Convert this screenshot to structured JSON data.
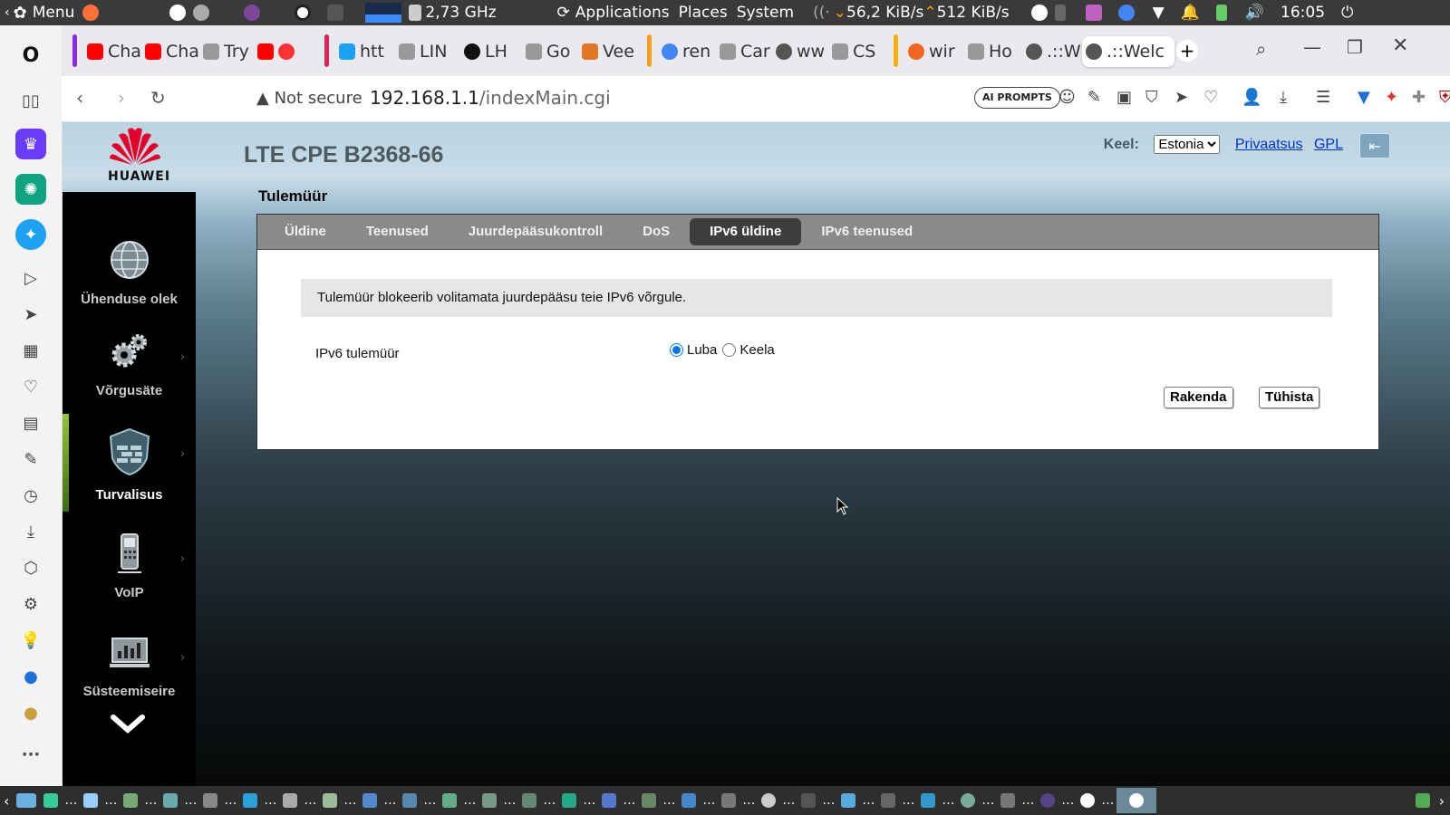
{
  "os_panel": {
    "menu_label": "Menu",
    "cpu_freq": "2,73 GHz",
    "applications": "Applications",
    "places": "Places",
    "system": "System",
    "net_down": "56,2 KiB/s",
    "net_up": "512 KiB/s",
    "clock": "16:05"
  },
  "browser": {
    "tabs": [
      {
        "label": "Cha",
        "color": "#ff0000"
      },
      {
        "label": "Cha",
        "color": "#ff0000"
      },
      {
        "label": "Try",
        "color": "#888888"
      },
      {
        "label": "",
        "color": "#ff0000"
      },
      {
        "label": "htt",
        "color": "#1da1f2"
      },
      {
        "label": "LIN",
        "color": "#888888"
      },
      {
        "label": "LH",
        "color": "#111111"
      },
      {
        "label": "Go",
        "color": "#888888"
      },
      {
        "label": "Vee",
        "color": "#e27625"
      },
      {
        "label": "ren",
        "color": "#4285f4"
      },
      {
        "label": "Car",
        "color": "#888888"
      },
      {
        "label": "ww",
        "color": "#444444"
      },
      {
        "label": "CS",
        "color": "#888888"
      },
      {
        "label": "wir",
        "color": "#f26522"
      },
      {
        "label": "Ho",
        "color": "#888888"
      },
      {
        "label": ".::W",
        "color": "#444444"
      },
      {
        "label": ".::Welc",
        "color": "#444444"
      }
    ],
    "not_secure": "Not secure",
    "url_host": "192.168.1.1",
    "url_path": "/indexMain.cgi",
    "ai_prompts": "AI PROMPTS"
  },
  "router": {
    "brand": "HUAWEI",
    "device_title": "LTE CPE B2368-66",
    "language_label": "Keel:",
    "language_value": "Estonia",
    "privacy_link": "Privaatsus",
    "gpl_link": "GPL",
    "menu": [
      {
        "label": "Ühenduse olek"
      },
      {
        "label": "Võrgusäte"
      },
      {
        "label": "Turvalisus"
      },
      {
        "label": "VoIP"
      },
      {
        "label": "Süsteemiseire"
      }
    ],
    "section_title": "Tulemüür",
    "tabs": [
      {
        "label": "Üldine"
      },
      {
        "label": "Teenused"
      },
      {
        "label": "Juurdepääsukontroll"
      },
      {
        "label": "DoS"
      },
      {
        "label": "IPv6 üldine"
      },
      {
        "label": "IPv6 teenused"
      }
    ],
    "info_text": "Tulemüür blokeerib volitamata juurdepääsu teie IPv6 võrgule.",
    "field_label": "IPv6 tulemüür",
    "option_enable": "Luba",
    "option_disable": "Keela",
    "selected_option": "Luba",
    "apply_button": "Rakenda",
    "cancel_button": "Tühista"
  }
}
